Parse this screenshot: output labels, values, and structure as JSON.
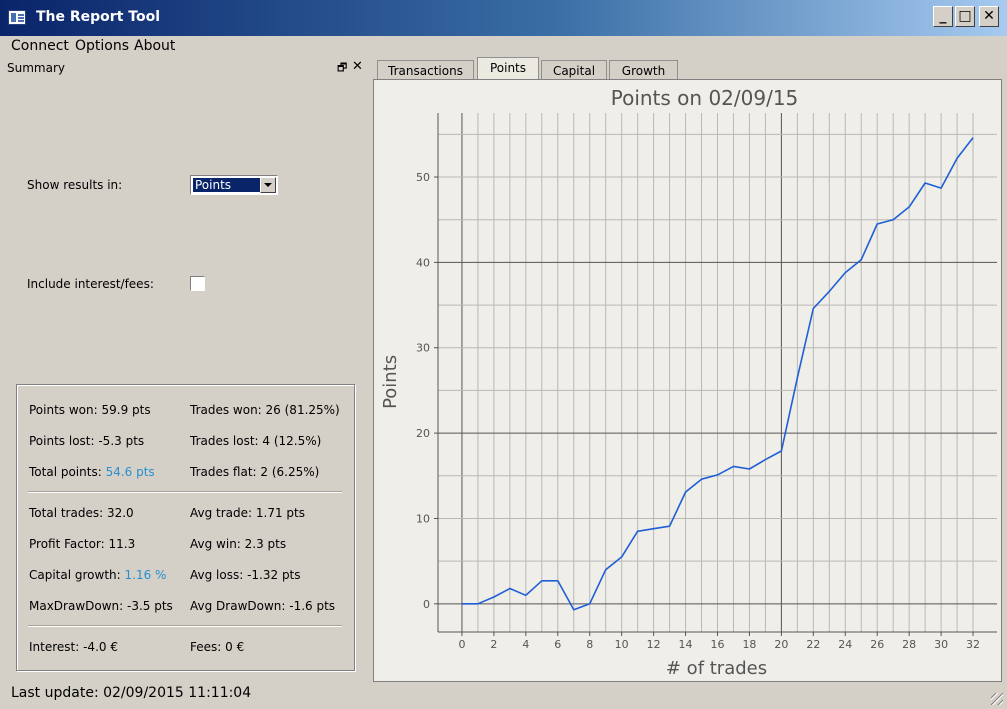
{
  "window": {
    "title": "The Report Tool",
    "controls": [
      "_",
      "□",
      "✕"
    ]
  },
  "menu": [
    "Connect",
    "Options",
    "About"
  ],
  "summary": {
    "title": "Summary",
    "show_results_label": "Show results in:",
    "show_results_value": "Points",
    "include_fees_label": "Include interest/fees:",
    "include_fees_checked": false,
    "stats": {
      "points_won": "Points won: 59.9 pts",
      "trades_won": "Trades won: 26 (81.25%)",
      "points_lost": "Points lost: -5.3 pts",
      "trades_lost": "Trades lost: 4 (12.5%)",
      "total_points_label": "Total points: ",
      "total_points_value": "54.6 pts",
      "trades_flat": "Trades flat: 2 (6.25%)",
      "total_trades": "Total trades: 32.0",
      "avg_trade": "Avg trade: 1.71 pts",
      "profit_factor": "Profit Factor: 11.3",
      "avg_win": "Avg win: 2.3 pts",
      "capital_growth_label": "Capital growth: ",
      "capital_growth_value": "1.16 %",
      "avg_loss": "Avg loss: -1.32 pts",
      "max_drawdown": "MaxDrawDown: -3.5 pts",
      "avg_drawdown": "Avg DrawDown: -1.6 pts",
      "interest": "Interest: -4.0 €",
      "fees": "Fees: 0 €"
    }
  },
  "status": "Last update: 02/09/2015 11:11:04",
  "tabs": [
    "Transactions",
    "Points",
    "Capital",
    "Growth"
  ],
  "active_tab": 1,
  "colors": {
    "line": "#1e5fd6",
    "accent_text": "#2a8fcf",
    "title_bar_start": "#0a246a",
    "title_bar_end": "#a6caf0"
  },
  "chart_data": {
    "type": "line",
    "title": "Points on 02/09/15",
    "xlabel": "# of trades",
    "ylabel": "Points",
    "xlim": [
      -1.5,
      33.5
    ],
    "ylim": [
      -3.3,
      57.5
    ],
    "xticks": [
      0,
      2,
      4,
      6,
      8,
      10,
      12,
      14,
      16,
      18,
      20,
      22,
      24,
      26,
      28,
      30,
      32
    ],
    "yticks": [
      0,
      10,
      20,
      30,
      40,
      50
    ],
    "grid": true,
    "x": [
      0,
      1,
      2,
      3,
      4,
      5,
      6,
      7,
      8,
      9,
      10,
      11,
      12,
      13,
      14,
      15,
      16,
      17,
      18,
      19,
      20,
      21,
      22,
      23,
      24,
      25,
      26,
      27,
      28,
      29,
      30,
      31,
      32
    ],
    "y": [
      0,
      0,
      0.8,
      1.8,
      1.0,
      2.7,
      2.7,
      -0.7,
      0,
      4.0,
      5.5,
      8.5,
      8.8,
      9.1,
      13.1,
      14.6,
      15.1,
      16.1,
      15.8,
      16.9,
      17.9,
      26.5,
      34.6,
      36.6,
      38.8,
      40.3,
      44.5,
      45.0,
      46.5,
      49.3,
      48.7,
      52.2,
      54.6
    ]
  }
}
